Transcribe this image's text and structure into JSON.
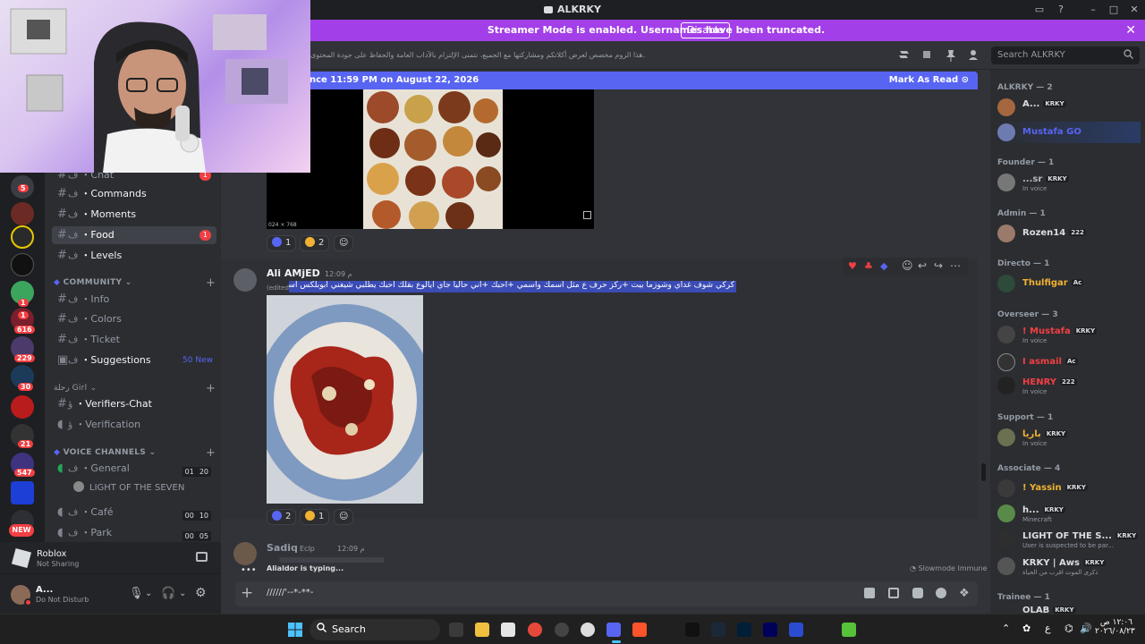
{
  "window": {
    "title": "ALKRKY"
  },
  "banner": {
    "message": "Streamer Mode is enabled. Usernames have been truncated.",
    "disable_label": "Disable"
  },
  "header": {
    "topic": "هذا الروم مخصص لعرض أكلاتكم ومشاركتها مع الجميع، نتمنى الإلتزام بالآداب العامة والحفاظ على جودة المحتوى.",
    "search_placeholder": "Search ALKRKY"
  },
  "rail": {
    "badges": [
      "5",
      "1",
      "1",
      "616",
      "229",
      "30",
      "21",
      "547"
    ],
    "new_label": "NEW"
  },
  "channels": {
    "items": [
      {
        "prefix": "ف",
        "name": "・Chat",
        "badge": "1"
      },
      {
        "prefix": "ف",
        "name": "・Commands"
      },
      {
        "prefix": "ف",
        "name": "・Moments"
      },
      {
        "prefix": "ف",
        "name": "・Food",
        "badge": "1"
      },
      {
        "prefix": "ف",
        "name": "・Levels"
      }
    ],
    "community_category": "COMMUNITY",
    "community": [
      {
        "prefix": "ف",
        "name": "・Info"
      },
      {
        "prefix": "ف",
        "name": "・Colors"
      },
      {
        "prefix": "ف",
        "name": "・Ticket"
      },
      {
        "prefix": "ف",
        "name": "・Suggestions",
        "tag": "50 New"
      }
    ],
    "girl_category": "رحلة Girl",
    "girl": [
      {
        "prefix": "ؤ",
        "name": "・Verifiers-Chat"
      },
      {
        "prefix": "ؤ",
        "name": "・Verification"
      }
    ],
    "voice_category": "VOICE CHANNELS",
    "voice": [
      {
        "prefix": "ف",
        "name": "・General",
        "a": "01",
        "b": "20"
      },
      {
        "prefix": "ف",
        "name": "・Café",
        "a": "00",
        "b": "10"
      },
      {
        "prefix": "ف",
        "name": "・Park",
        "a": "00",
        "b": "05"
      }
    ],
    "voice_member": "LIGHT OF THE SEVEN"
  },
  "user_panel": {
    "activity": "Roblox",
    "activity_status": "Not Sharing",
    "username": "A...",
    "status": "Do Not Disturb"
  },
  "chat": {
    "new_messages": "nce 11:59 PM on August 22, 2026",
    "mark_as_read": "Mark As Read",
    "image_caption": "024 × 768",
    "reactions_1": [
      {
        "count": "1"
      },
      {
        "count": "2"
      }
    ],
    "message_author": "Ali AMjED",
    "message_time": "12:09 م",
    "message_edited": "(edited)",
    "message_text": "كركي شوف غداي وشوزما بيت +ركز حرف ع مثل اسمك واسمي +احبك +اني حاليا جاي ايالوع بقلك احبك يطلبي شيغني ابوبلكس اسمي Ali90657",
    "reactions_2": [
      {
        "count": "2"
      },
      {
        "count": "1"
      }
    ],
    "next_author": "Sadiq",
    "next_tag": "Eclp",
    "next_time": "12:09 م",
    "typing": "Alialdor is typing...",
    "slowmode": "Slowmode Immune",
    "composer_text": "//////'--*-**-"
  },
  "members": {
    "groups": [
      {
        "title": "ALKRKY — 2"
      },
      {
        "title": "Founder — 1"
      },
      {
        "title": "Admin — 1"
      },
      {
        "title": "Directo — 1"
      },
      {
        "title": "Overseer — 3"
      },
      {
        "title": "Support — 1"
      },
      {
        "title": "Associate — 4"
      },
      {
        "title": "Trainee — 1"
      }
    ],
    "rows": [
      {
        "name": "A...",
        "tag": "KRKY",
        "color": "#dbdee1"
      },
      {
        "name": "Mustafa GO",
        "color": "#5865f2"
      },
      {
        "name": "...sr",
        "tag": "KRKY",
        "sub": "In voice",
        "color": "#b5bac1"
      },
      {
        "name": "Rozen14",
        "tag": "222",
        "color": "#dbdee1"
      },
      {
        "name": "Thulfigar",
        "tag": "Ac",
        "color": "#f0b232"
      },
      {
        "name": "! Mustafa",
        "tag": "KRKY",
        "sub": "In voice",
        "color": "#f23f43"
      },
      {
        "name": "I asmail",
        "tag": "Ac",
        "color": "#f23f43"
      },
      {
        "name": "HENRY",
        "tag": "222",
        "sub": "In voice",
        "color": "#f23f43"
      },
      {
        "name": "باريا",
        "tag": "KRKY",
        "sub": "In voice",
        "color": "#f0b232"
      },
      {
        "name": "! Yassin",
        "tag": "KRKY",
        "color": "#f0b232"
      },
      {
        "name": "h...",
        "tag": "KRKY",
        "sub": "Minecraft",
        "color": "#dbdee1"
      },
      {
        "name": "LIGHT OF THE S...",
        "tag": "KRKY",
        "sub": "User is suspected to be par...",
        "color": "#dbdee1"
      },
      {
        "name": "KRKY | Aws",
        "tag": "KRKY",
        "sub": "ذكرى الموت اقرب من الحياة",
        "color": "#dbdee1"
      },
      {
        "name": "OLAB",
        "tag": "KRKY",
        "color": "#dbdee1"
      }
    ]
  },
  "taskbar": {
    "search": "Search",
    "time": "١٢:٠٦ ص",
    "date": "٢٠٢٦/٠٨/٢٣",
    "lang": "ع"
  },
  "colors": {
    "accent": "#5865f2",
    "banner": "#a33fe8",
    "danger": "#f23f43"
  }
}
